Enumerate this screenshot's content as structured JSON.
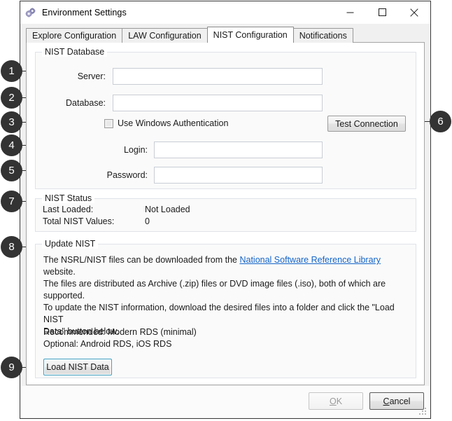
{
  "window": {
    "title": "Environment Settings",
    "icon": "gears-icon",
    "controls": {
      "minimize": "minimize-icon",
      "maximize": "maximize-icon",
      "close": "close-icon"
    }
  },
  "tabs": [
    {
      "label": "Explore Configuration",
      "active": false
    },
    {
      "label": "LAW Configuration",
      "active": false
    },
    {
      "label": "NIST Configuration",
      "active": true
    },
    {
      "label": "Notifications",
      "active": false
    }
  ],
  "nist_database": {
    "legend": "NIST Database",
    "server": {
      "label": "Server:",
      "value": "",
      "placeholder": ""
    },
    "database": {
      "label": "Database:",
      "value": "",
      "placeholder": ""
    },
    "use_windows_auth": {
      "label": "Use Windows Authentication",
      "checked": false
    },
    "login": {
      "label": "Login:",
      "value": "",
      "placeholder": ""
    },
    "password": {
      "label": "Password:",
      "value": "",
      "placeholder": ""
    },
    "test_connection_label": "Test Connection"
  },
  "nist_status": {
    "legend": "NIST Status",
    "last_loaded_label": "Last Loaded:",
    "last_loaded_value": "Not Loaded",
    "total_values_label": "Total NIST Values:",
    "total_values_value": "0"
  },
  "update_nist": {
    "legend": "Update NIST",
    "line1_pre": "The NSRL/NIST files can be downloaded from the ",
    "link_text": "National Software Reference Library",
    "line1_post": " website.",
    "paragraph2_line1": "The files are distributed as Archive (.zip) files or DVD image files (.iso), both of which are supported.",
    "paragraph2_line2": "To update the NIST information, download the desired files into a folder and click the \"Load NIST",
    "paragraph2_line3": "Data\" button below.",
    "recommended": "Recommended: Modern RDS (minimal)",
    "optional": "Optional: Android RDS, iOS RDS",
    "load_button_label": "Load NIST Data"
  },
  "footer": {
    "ok_label": "OK",
    "ok_accel": "O",
    "ok_disabled": true,
    "cancel_label": "Cancel",
    "cancel_accel": "C"
  },
  "callouts": [
    {
      "number": "1",
      "target": "server-field"
    },
    {
      "number": "2",
      "target": "database-field"
    },
    {
      "number": "3",
      "target": "use-windows-authentication-checkbox"
    },
    {
      "number": "4",
      "target": "login-field"
    },
    {
      "number": "5",
      "target": "password-field"
    },
    {
      "number": "6",
      "target": "test-connection-button"
    },
    {
      "number": "7",
      "target": "nist-status-group"
    },
    {
      "number": "8",
      "target": "update-nist-group"
    },
    {
      "number": "9",
      "target": "load-nist-data-button"
    }
  ],
  "colors": {
    "callout_bg": "#333333",
    "link": "#1464c8",
    "focus_border": "#3f9fbf",
    "window_border": "#3a3a3a"
  }
}
